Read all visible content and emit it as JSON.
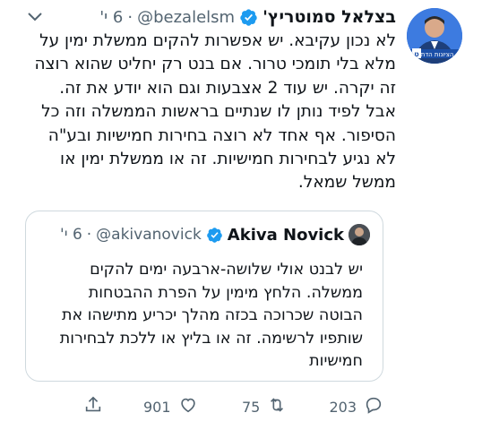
{
  "tweet": {
    "author_name": "בצלאל סמוטריץ'",
    "author_handle": "@bezalelsm",
    "separator": "·",
    "time": "6 י'",
    "avatar_banner": "הציונות הדתית",
    "avatar_badge": "ט",
    "body_lines": [
      "לא נכון עקיבא. יש אפשרות להקים ממשלת ימין על",
      "מלא בלי תומכי טרור. אם בנט רק יחליט שהוא רוצה",
      "זה יקרה. יש עוד 2 אצבעות וגם הוא יודע את זה.",
      "אבל לפיד נותן לו שנתיים בראשות הממשלה וזה כל",
      "הסיפור. אף אחד לא רוצה בחירות חמישיות ובע\"ה",
      "לא נגיע לבחירות חמישיות. זה או ממשלת ימין או",
      "ממשל שמאל."
    ]
  },
  "quoted": {
    "author_name": "Akiva Novick",
    "author_handle": "@akivanovick",
    "separator": "·",
    "time": "6 י'",
    "body_lines": [
      "יש לבנט אולי שלושה-ארבעה ימים להקים",
      "ממשלה. הלחץ מימין על הפרת ההבטחות",
      "הבוטה שכרוכה בכזה מהלך יכריע מתישהו את",
      "שותפיו לרשימה. זה או בליץ או ללכת לבחירות",
      "חמישיות"
    ]
  },
  "actions": {
    "reply_count": "203",
    "retweet_count": "75",
    "like_count": "901",
    "icons": [
      "reply-icon",
      "retweet-icon",
      "like-icon",
      "share-icon"
    ]
  },
  "colors": {
    "verified": "#1d9bf0",
    "muted": "#536471",
    "border": "#cfd9de"
  }
}
